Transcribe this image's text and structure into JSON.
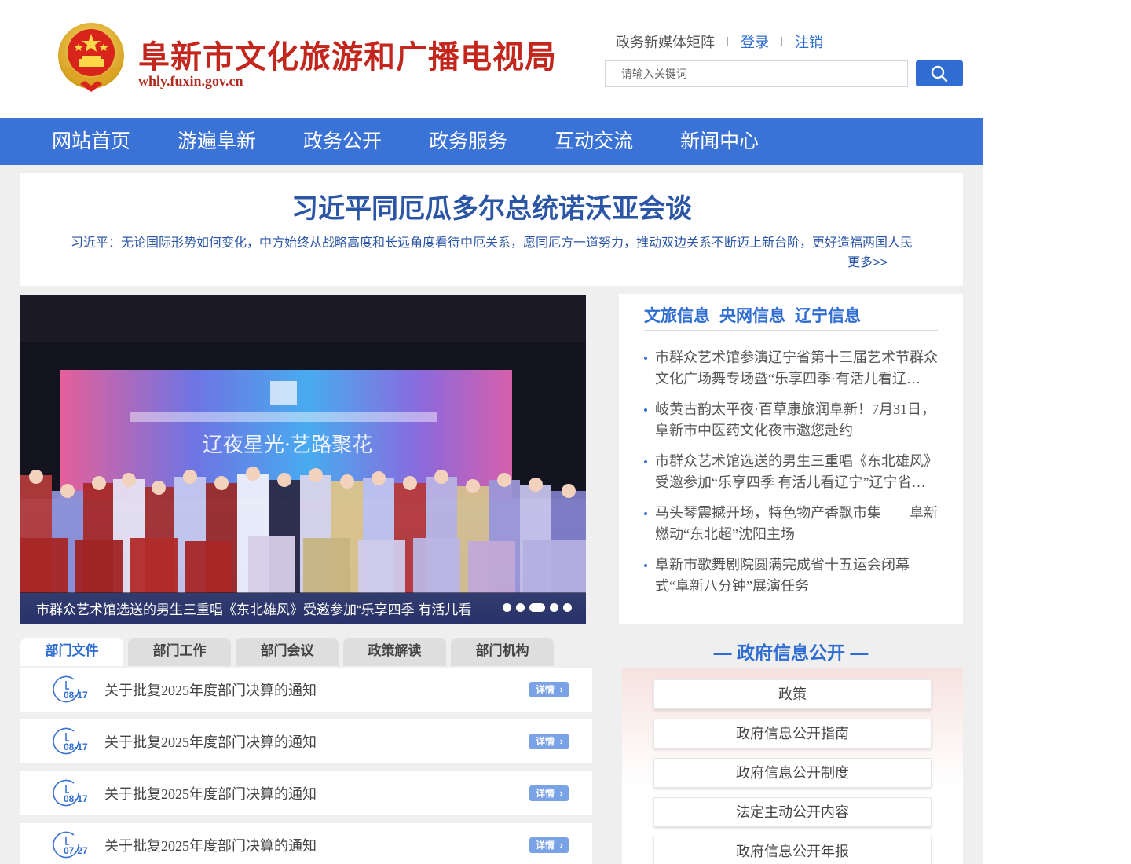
{
  "header": {
    "site_title": "阜新市文化旅游和广播电视局",
    "site_domain": "whly.fuxin.gov.cn",
    "links": {
      "media": "政务新媒体矩阵",
      "login": "登录",
      "logout": "注销"
    },
    "search": {
      "placeholder": "请输入关键词"
    }
  },
  "nav": {
    "items": [
      "网站首页",
      "游遍阜新",
      "政务公开",
      "政务服务",
      "互动交流",
      "新闻中心"
    ]
  },
  "headline": {
    "title": "习近平同厄瓜多尔总统诺沃亚会谈",
    "subtitle": "习近平：无论国际形势如何变化，中方始终从战略高度和长远角度看待中厄关系，愿同厄方一道努力，推动双边关系不断迈上新台阶，更好造福两国人民",
    "more": "更多>>"
  },
  "slideshow": {
    "caption": "市群众艺术馆选送的男生三重唱《东北雄风》受邀参加“乐享四季 有活儿看",
    "stage_text": "辽夜星光·艺路聚花",
    "dot_count": 5,
    "active_dot": 3
  },
  "news": {
    "tabs": [
      "文旅信息",
      "央网信息",
      "辽宁信息"
    ],
    "items": [
      "市群众艺术馆参演辽宁省第十三届艺术节群众文化广场舞专场暨“乐享四季·有活儿看辽宁”群众文化活动",
      "岐黄古韵太平夜·百草康旅润阜新！7月31日，阜新市中医药文化夜市邀您赴约",
      "市群众艺术馆选送的男生三重唱《东北雄风》受邀参加“乐享四季 有活儿看辽宁”辽宁省群众文化活动",
      "马头琴震撼开场，特色物产香飘市集——阜新燃动“东北超”沈阳主场",
      "阜新市歌舞剧院圆满完成省十五运会闭幕式“阜新八分钟”展演任务"
    ]
  },
  "docs": {
    "tabs": [
      "部门文件",
      "部门工作",
      "部门会议",
      "政策解读",
      "部门机构"
    ],
    "detail_label": "详情",
    "rows": [
      {
        "date": "08-17",
        "title": "关于批复2025年度部门决算的通知"
      },
      {
        "date": "08-17",
        "title": "关于批复2025年度部门决算的通知"
      },
      {
        "date": "08-17",
        "title": "关于批复2025年度部门决算的通知"
      },
      {
        "date": "07-27",
        "title": "关于批复2025年度部门决算的通知"
      }
    ]
  },
  "gov_info": {
    "title": "— 政府信息公开 —",
    "buttons": [
      "政策",
      "政府信息公开指南",
      "政府信息公开制度",
      "法定主动公开内容",
      "政府信息公开年报"
    ]
  },
  "colors": {
    "nav_blue": "#3a72d6",
    "title_red": "#c3261c",
    "link_blue": "#2f6dd3",
    "headline_blue": "#2b56a6"
  },
  "icons": [
    "national-emblem",
    "search-icon",
    "clock-icon",
    "chevron-right-icon"
  ]
}
